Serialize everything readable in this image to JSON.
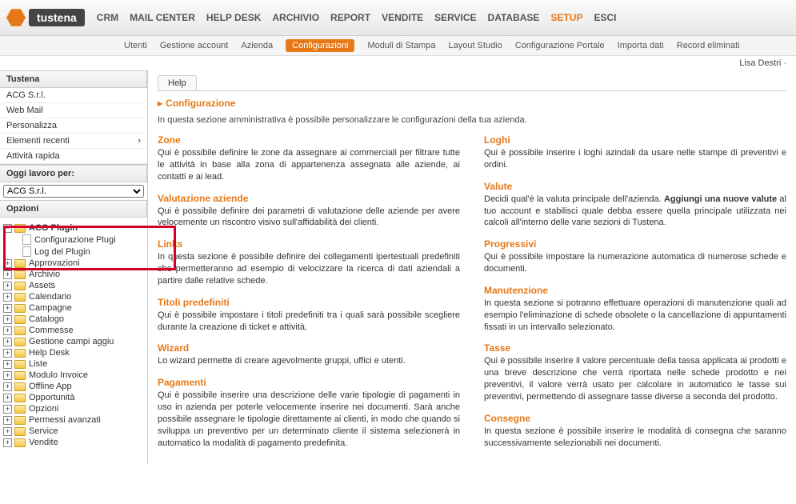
{
  "logo": "tustena",
  "topnav": [
    "CRM",
    "MAIL CENTER",
    "HELP DESK",
    "ARCHIVIO",
    "REPORT",
    "VENDITE",
    "SERVICE",
    "DATABASE",
    "SETUP",
    "ESCI"
  ],
  "topnav_active": 8,
  "subnav": [
    "Utenti",
    "Gestione account",
    "Azienda",
    "Configurazioni",
    "Moduli di Stampa",
    "Layout Studio",
    "Configurazione Portale",
    "Importa dati",
    "Record eliminati"
  ],
  "subnav_active": 3,
  "user": "Lisa Destri",
  "side_title1": "Tustena",
  "side_menu": [
    "ACG S.r.l.",
    "Web Mail",
    "Personalizza",
    "Elementi recenti",
    "Attività rapida"
  ],
  "side_title2": "Oggi lavoro per:",
  "company_selected": "ACG S.r.l.",
  "side_title3": "Opzioni",
  "tree_root": {
    "label": "ACG Plugin",
    "expanded": true,
    "children": [
      "Configurazione Plugi",
      "Log del Plugin"
    ]
  },
  "tree_items": [
    "Approvazioni",
    "Archivio",
    "Assets",
    "Calendario",
    "Campagne",
    "Catalogo",
    "Commesse",
    "Gestione campi aggiu",
    "Help Desk",
    "Liste",
    "Modulo Invoice",
    "Offline App",
    "Opportunità",
    "Opzioni",
    "Permessi avanzati",
    "Service",
    "Vendite"
  ],
  "tab_help": "Help",
  "page_title": "Configurazione",
  "intro": "In questa sezione amministrativa è possibile personalizzare le configurazioni della tua azienda.",
  "left_sections": [
    {
      "h": "Zone",
      "p": "Qui è possibile definire le zone da assegnare ai commerciali per filtrare tutte le attività in base alla zona di appartenenza assegnata alle aziende, ai contatti e ai lead."
    },
    {
      "h": "Valutazione aziende",
      "p": "Qui è possibile definire dei parametri di valutazione delle aziende per avere velocemente un riscontro visivo sull'affidabilità dei clienti."
    },
    {
      "h": "Links",
      "p": "In questa sezione è possibile definire dei collegamenti ipertestuali predefiniti che permetteranno ad esempio di velocizzare la ricerca di dati aziendali a partire dalle relative schede."
    },
    {
      "h": "Titoli predefiniti",
      "p": "Qui è possibile impostare i titoli predefiniti tra i quali sarà possibile scegliere durante la creazione di ticket e attività."
    },
    {
      "h": "Wizard",
      "p": "Lo wizard permette di creare agevolmente gruppi, uffici e utenti."
    },
    {
      "h": "Pagamenti",
      "p": "Qui è possibile inserire una descrizione delle varie tipologie di pagamenti in uso in azienda per poterle velocemente inserire nei documenti. Sarà anche possibile assegnare le tipologie direttamente ai clienti, in modo che quando si sviluppa un preventivo per un determinato cliente il sistema selezionerà in automatico la modalità di pagamento predefinita."
    }
  ],
  "right_sections": [
    {
      "h": "Loghi",
      "p": "Qui è possibile inserire i loghi azindali da usare nelle stampe di preventivi e ordini."
    },
    {
      "h": "Valute",
      "p": "Decidi qual'è la valuta principale dell'azienda. <b>Aggiungi una nuove valute</b> al tuo account e stabilisci quale debba essere quella principale utilizzata nei calcoli all'interno delle varie sezioni di Tustena."
    },
    {
      "h": "Progressivi",
      "p": "Qui è possibile impostare la numerazione automatica di numerose schede e documenti."
    },
    {
      "h": "Manutenzione",
      "p": "In questa sezione si potranno effettuare operazioni di manutenzione quali ad esempio l'eliminazione di schede obsolete o la cancellazione di appuntamenti fissati in un intervallo selezionato."
    },
    {
      "h": "Tasse",
      "p": "Qui è possibile inserire il valore percentuale della tassa applicata ai prodotti e una breve descrizione che verrà riportata nelle schede prodotto e nei preventivi, il valore verrà usato per calcolare in automatico le tasse sui preventivi, permettendo di assegnare tasse diverse a seconda del prodotto."
    },
    {
      "h": "Consegne",
      "p": "In questa sezione è possibile inserire le modalità di consegna che saranno successivamente selezionabili nei documenti."
    }
  ]
}
